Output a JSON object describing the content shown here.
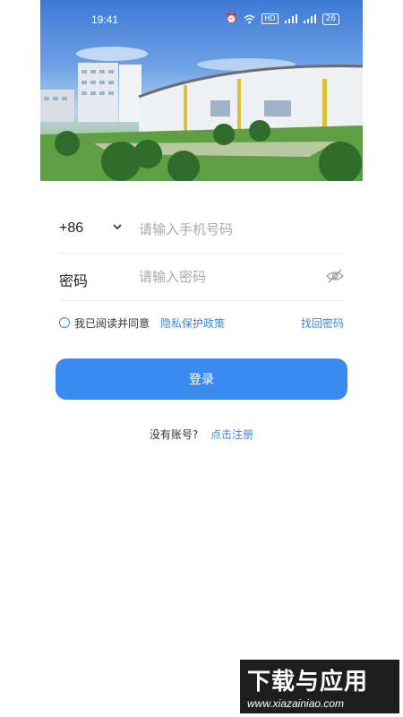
{
  "status_bar": {
    "time": "19:41",
    "icons": [
      "alarm-icon",
      "wifi-icon",
      "hd-icon",
      "signal-icon",
      "signal-icon",
      "battery-icon"
    ],
    "hd_label": "HD",
    "battery": "26"
  },
  "form": {
    "country_code": "+86",
    "phone_placeholder": "请输入手机号码",
    "password_label": "密码",
    "password_placeholder": "请输入密码"
  },
  "agreement": {
    "text": "我已阅读并同意",
    "policy_link": "隐私保护政策",
    "forgot_password": "找回密码"
  },
  "login_label": "登录",
  "register": {
    "question": "没有账号?",
    "link": "点击注册"
  },
  "watermark": {
    "title": "下载与应用",
    "url": "www.xiazainiao.com"
  },
  "colors": {
    "accent": "#3a8bef",
    "link": "#3a86e8"
  }
}
